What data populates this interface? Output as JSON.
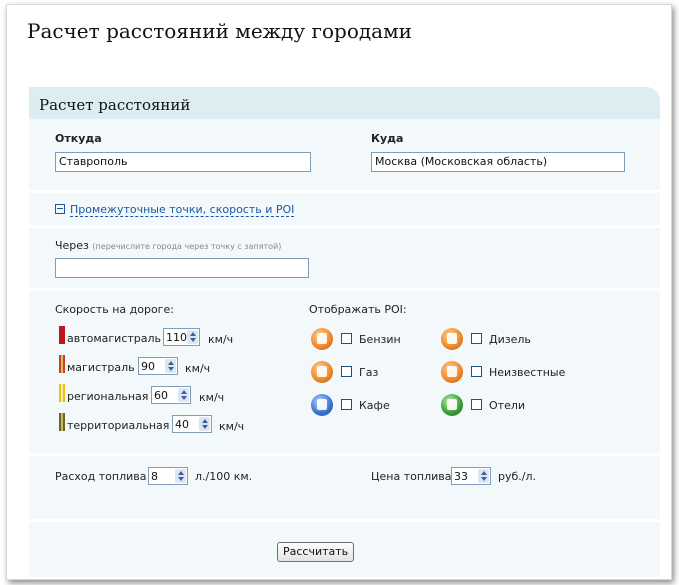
{
  "page": {
    "title": "Расчет расстояний между городами"
  },
  "card": {
    "title": "Расчет расстояний"
  },
  "route": {
    "from_label": "Откуда",
    "from_value": "Ставрополь",
    "to_label": "Куда",
    "to_value": "Москва (Московская область)"
  },
  "toggle": {
    "label": "Промежуточные точки, скорость и POI",
    "state_symbol": "⊟"
  },
  "via": {
    "label": "Через",
    "hint": "(перечислите города через точку с запятой)",
    "value": ""
  },
  "speed": {
    "title": "Скорость на дороге:",
    "unit": "км/ч",
    "rows": [
      {
        "label": "автомагистраль",
        "value": "110",
        "color": "#c0141b"
      },
      {
        "label": "магистраль",
        "value": "90",
        "color": "#c8412a"
      },
      {
        "label": "региональная",
        "value": "60",
        "color": "#e7c21a"
      },
      {
        "label": "территориальная",
        "value": "40",
        "color": "#6e6428"
      }
    ]
  },
  "poi": {
    "title": "Отображать POI:",
    "items": [
      {
        "label": "Бензин",
        "icon": "gas-station-icon",
        "color": "#f08a2c",
        "checked": false
      },
      {
        "label": "Дизель",
        "icon": "diesel-station-icon",
        "color": "#f08a2c",
        "checked": false
      },
      {
        "label": "Газ",
        "icon": "gas-icon",
        "color": "#f08a2c",
        "checked": false
      },
      {
        "label": "Неизвестные",
        "icon": "unknown-station-icon",
        "color": "#f08a2c",
        "checked": false
      },
      {
        "label": "Кафе",
        "icon": "cafe-icon",
        "color": "#3a78d0",
        "checked": false
      },
      {
        "label": "Отели",
        "icon": "hotel-icon",
        "color": "#3f9e3a",
        "checked": false
      }
    ]
  },
  "fuel": {
    "consumption_label": "Расход топлива",
    "consumption_value": "8",
    "consumption_unit": "л./100 км.",
    "price_label": "Цена топлива",
    "price_value": "33",
    "price_unit": "руб./л."
  },
  "actions": {
    "calculate_label": "Рассчитать"
  }
}
